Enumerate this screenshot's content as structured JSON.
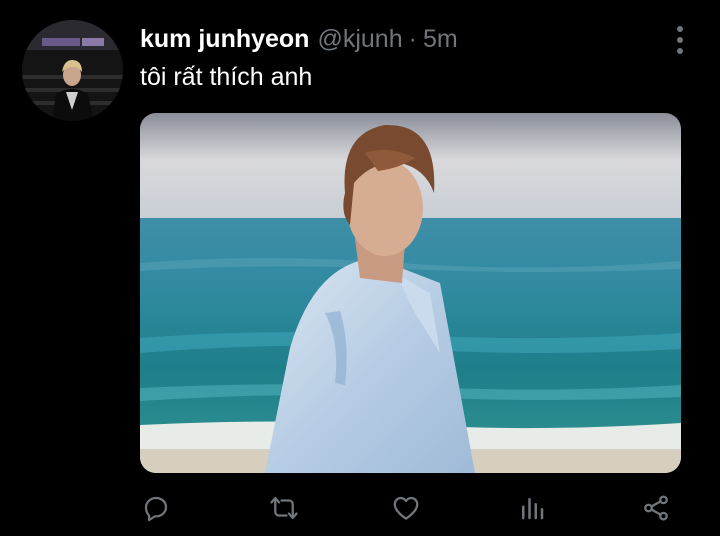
{
  "tweet": {
    "display_name": "kum junhyeon",
    "handle": "@kjunh",
    "separator": "·",
    "time": "5m",
    "text": "tôi rất thích anh"
  },
  "icons": {
    "more": "more-vertical-icon",
    "reply": "reply-icon",
    "retweet": "retweet-icon",
    "like": "heart-icon",
    "analytics": "analytics-icon",
    "share": "share-icon"
  },
  "colors": {
    "background": "#000000",
    "text": "#ffffff",
    "secondary": "#71767b"
  }
}
